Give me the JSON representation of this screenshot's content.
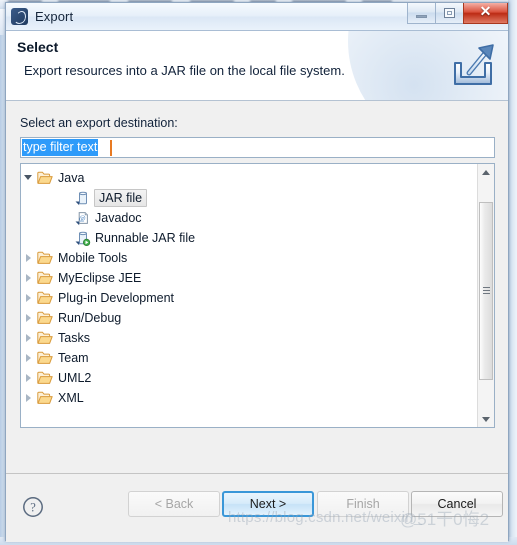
{
  "window": {
    "title": "Export",
    "app_icon": "eclipse-icon",
    "controls": {
      "minimize": "minimize-icon",
      "maximize": "maximize-icon",
      "close": "✕"
    }
  },
  "header": {
    "title": "Select",
    "description": "Export resources into a JAR file on the local file system.",
    "icon": "export-wizard-icon"
  },
  "main": {
    "destination_label": "Select an export destination:",
    "filter": {
      "value": "type filter text",
      "placeholder": "type filter text",
      "selected": true
    },
    "tree": [
      {
        "label": "Java",
        "icon": "folder-open-icon",
        "state": "expanded",
        "indent": 0,
        "selected": false
      },
      {
        "label": "JAR file",
        "icon": "jar-file-icon",
        "state": "leaf",
        "indent": 2,
        "selected": true
      },
      {
        "label": "Javadoc",
        "icon": "javadoc-icon",
        "state": "leaf",
        "indent": 2,
        "selected": false
      },
      {
        "label": "Runnable JAR file",
        "icon": "runnable-jar-icon",
        "state": "leaf",
        "indent": 2,
        "selected": false
      },
      {
        "label": "Mobile Tools",
        "icon": "folder-open-icon",
        "state": "collapsed",
        "indent": 0,
        "selected": false
      },
      {
        "label": "MyEclipse JEE",
        "icon": "folder-open-icon",
        "state": "collapsed",
        "indent": 0,
        "selected": false
      },
      {
        "label": "Plug-in Development",
        "icon": "folder-open-icon",
        "state": "collapsed",
        "indent": 0,
        "selected": false
      },
      {
        "label": "Run/Debug",
        "icon": "folder-open-icon",
        "state": "collapsed",
        "indent": 0,
        "selected": false
      },
      {
        "label": "Tasks",
        "icon": "folder-open-icon",
        "state": "collapsed",
        "indent": 0,
        "selected": false
      },
      {
        "label": "Team",
        "icon": "folder-open-icon",
        "state": "collapsed",
        "indent": 0,
        "selected": false
      },
      {
        "label": "UML2",
        "icon": "folder-open-icon",
        "state": "collapsed",
        "indent": 0,
        "selected": false
      },
      {
        "label": "XML",
        "icon": "folder-open-icon",
        "state": "collapsed",
        "indent": 0,
        "selected": false
      }
    ]
  },
  "footer": {
    "help_icon": "help-question-icon",
    "buttons": {
      "back": "< Back",
      "next": "Next >",
      "finish": "Finish",
      "cancel": "Cancel"
    }
  },
  "watermark": {
    "url": "https://blog.csdn.net/weixin_",
    "tail": "@51干0悔2"
  },
  "colors": {
    "accent": "#3a97d8",
    "selection": "#2e9bfa",
    "caret": "#e87a22",
    "close_button": "#bc2b14",
    "folder": "#f3c173"
  }
}
